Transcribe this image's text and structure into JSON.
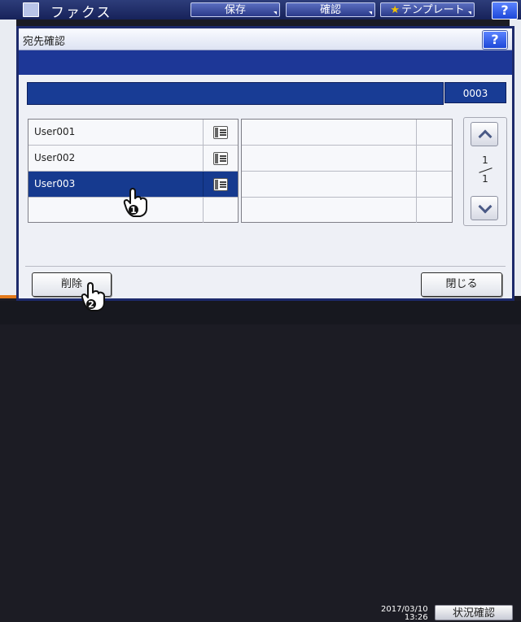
{
  "background": {
    "app_title": "ファクス",
    "buttons": [
      "保存",
      "確認",
      "テンプレート"
    ],
    "help_label": "?",
    "datetime_line1": "2017/03/10",
    "datetime_line2": "13:26",
    "status_button": "状況確認"
  },
  "dialog": {
    "title": "宛先確認",
    "help_label": "?",
    "destination_count": "0003",
    "list": [
      {
        "name": "User001",
        "icon": "fax-icon",
        "selected": false
      },
      {
        "name": "User002",
        "icon": "fax-icon",
        "selected": false
      },
      {
        "name": "User003",
        "icon": "fax-icon",
        "selected": true
      },
      {
        "name": "",
        "icon": "",
        "selected": false
      }
    ],
    "pagination": {
      "current": "1",
      "total": "1"
    },
    "delete_button": "削除",
    "close_button": "閉じる"
  },
  "hints": {
    "step1": "1",
    "step2": "2"
  },
  "colors": {
    "selected_row": "#163a8f",
    "header_blue": "#1d3797",
    "accent_orange": "#e2791b"
  }
}
